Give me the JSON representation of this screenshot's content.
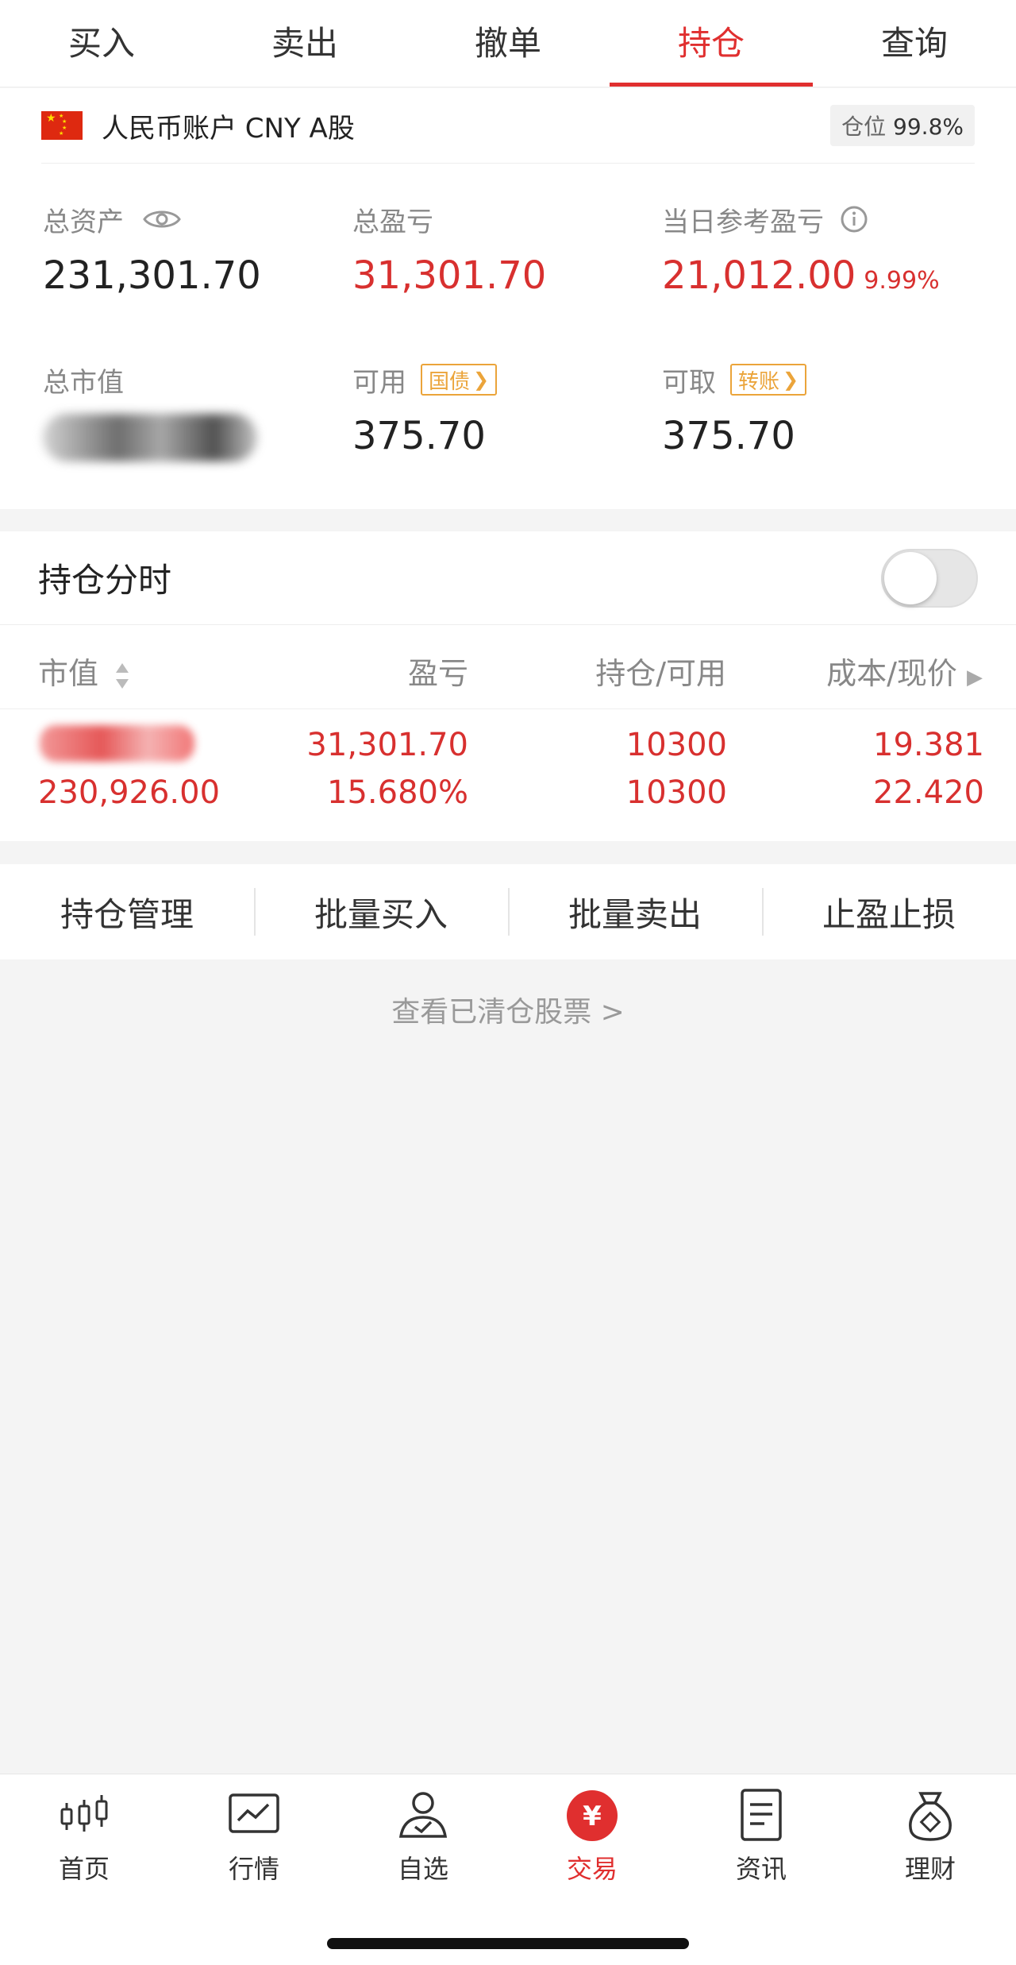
{
  "tabs": [
    {
      "label": "买入",
      "active": false
    },
    {
      "label": "卖出",
      "active": false
    },
    {
      "label": "撤单",
      "active": false
    },
    {
      "label": "持仓",
      "active": true
    },
    {
      "label": "查询",
      "active": false
    }
  ],
  "account": {
    "name": "人民币账户 CNY A股",
    "position_label": "仓位",
    "position_value": "99.8%",
    "total_assets_label": "总资产",
    "total_assets": "231,301.70",
    "total_pnl_label": "总盈亏",
    "total_pnl": "31,301.70",
    "daily_pnl_label": "当日参考盈亏",
    "daily_pnl": "21,012.00",
    "daily_pnl_pct": "9.99%",
    "market_value_label": "总市值",
    "available_label": "可用",
    "available_tag": "国债",
    "available": "375.70",
    "withdrawable_label": "可取",
    "withdrawable_tag": "转账",
    "withdrawable": "375.70"
  },
  "holdings": {
    "title": "持仓分时",
    "toggle_on": false,
    "columns": {
      "market_value": "市值",
      "pnl": "盈亏",
      "position": "持仓/可用",
      "cost": "成本/现价"
    },
    "rows": [
      {
        "market_value": "230,926.00",
        "pnl": "31,301.70",
        "pnl_pct": "15.680%",
        "position": "10300",
        "available": "10300",
        "cost": "19.381",
        "price": "22.420"
      }
    ]
  },
  "actions": [
    "持仓管理",
    "批量买入",
    "批量卖出",
    "止盈止损"
  ],
  "cleared_link": "查看已清仓股票 >",
  "nav": [
    {
      "label": "首页",
      "icon": "candlestick-icon",
      "active": false
    },
    {
      "label": "行情",
      "icon": "chart-icon",
      "active": false
    },
    {
      "label": "自选",
      "icon": "user-check-icon",
      "active": false
    },
    {
      "label": "交易",
      "icon": "yuan-icon",
      "active": true
    },
    {
      "label": "资讯",
      "icon": "document-icon",
      "active": false
    },
    {
      "label": "理财",
      "icon": "money-bag-icon",
      "active": false
    }
  ],
  "colors": {
    "accent": "#e02f2f",
    "gain": "#d8302f",
    "tag": "#eba43a"
  }
}
